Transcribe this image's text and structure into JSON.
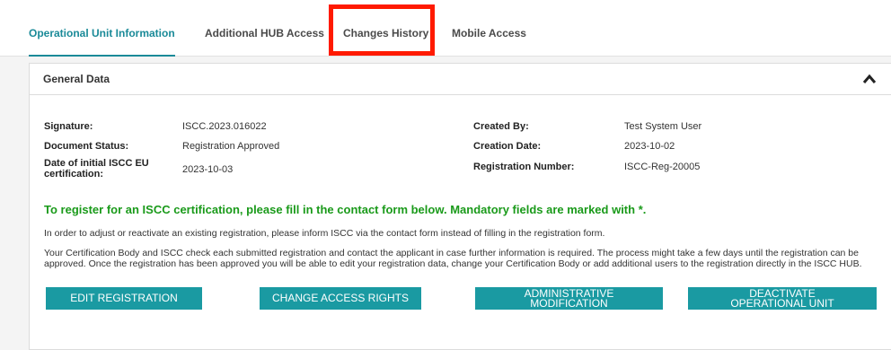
{
  "tabs": [
    {
      "label": "Operational Unit Information",
      "active": true
    },
    {
      "label": "Additional HUB Access",
      "active": false
    },
    {
      "label": "Changes History",
      "active": false
    },
    {
      "label": "Mobile Access",
      "active": false
    }
  ],
  "panel": {
    "title": "General Data",
    "fields_left": [
      {
        "label": "Signature:",
        "value": "ISCC.2023.016022"
      },
      {
        "label": "Document Status:",
        "value": "Registration Approved"
      },
      {
        "label": "Date of initial ISCC EU certification:",
        "value": "2023-10-03"
      }
    ],
    "fields_right": [
      {
        "label": "Created By:",
        "value": "Test System User"
      },
      {
        "label": "Creation Date:",
        "value": "2023-10-02"
      },
      {
        "label": "Registration Number:",
        "value": "ISCC-Reg-20005"
      }
    ],
    "notice": "To register for an ISCC certification, please fill in the contact form below. Mandatory fields are marked with *.",
    "para1": "In order to adjust or reactivate an existing registration, please inform ISCC via the contact form instead of filling in the registration form.",
    "para2": "Your Certification Body and ISCC check each submitted registration and contact the applicant in case further information is required. The process might take a few days until the registration can be approved. Once the registration has been approved you will be able to edit your registration data, change your Certification Body or add additional users to the registration directly in the ISCC HUB.",
    "buttons": {
      "edit": "EDIT REGISTRATION",
      "access": "CHANGE ACCESS RIGHTS",
      "admin_line1": "ADMINISTRATIVE",
      "admin_line2": "MODIFICATION",
      "deactivate_line1": "DEACTIVATE",
      "deactivate_line2": "OPERATIONAL UNIT"
    }
  },
  "colors": {
    "accent": "#1a8a98",
    "button": "#1a9aa2",
    "notice": "#1a9a1a",
    "highlight": "#ff1a00"
  }
}
